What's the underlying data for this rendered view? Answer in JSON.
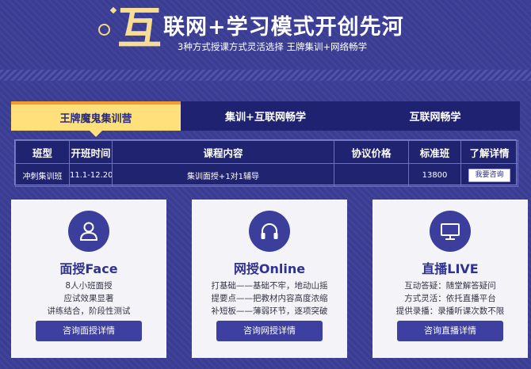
{
  "banner": {
    "big_char": "互",
    "title": "联网+学习模式开创先河",
    "subtitle": "3种方式授课方式灵活选择 王牌集训+网络畅学"
  },
  "tabs": [
    {
      "label": "王牌魔鬼集训营",
      "active": true
    },
    {
      "label": "集训+互联网畅学",
      "active": false
    },
    {
      "label": "互联网畅学",
      "active": false
    }
  ],
  "table": {
    "headers": [
      "班型",
      "开班时间",
      "课程内容",
      "协议价格",
      "标准班",
      "了解详情"
    ],
    "row": {
      "type": "冲刺集训班",
      "time": "11.1-12.20",
      "content": "集训面授+1对1辅导",
      "agreement_price": "",
      "standard_price": "13800",
      "button": "我要咨询"
    }
  },
  "cards": [
    {
      "icon": "user-icon",
      "title": "面授Face",
      "lines": [
        "8人小班面授",
        "应试效果显著",
        "讲练结合，阶段性测试"
      ],
      "button": "咨询面授详情"
    },
    {
      "icon": "headphones-icon",
      "title": "网授Online",
      "lines": [
        "打基础——基础不牢，地动山摇",
        "提要点——把教材内容高度浓缩",
        "补短板——薄弱环节，逐项突破"
      ],
      "button": "咨询网授详情"
    },
    {
      "icon": "monitor-icon",
      "title": "直播LIVE",
      "lines": [
        "互动答疑：随堂解答疑问",
        "方式灵活：依托直播平台",
        "提供录播：录播听课次数不限"
      ],
      "button": "咨询直播详情"
    }
  ],
  "colors": {
    "background": "#3a3d93",
    "accent_yellow": "#ffe07a",
    "accent_orange": "#f39b2f",
    "card_title": "#2f3291"
  }
}
